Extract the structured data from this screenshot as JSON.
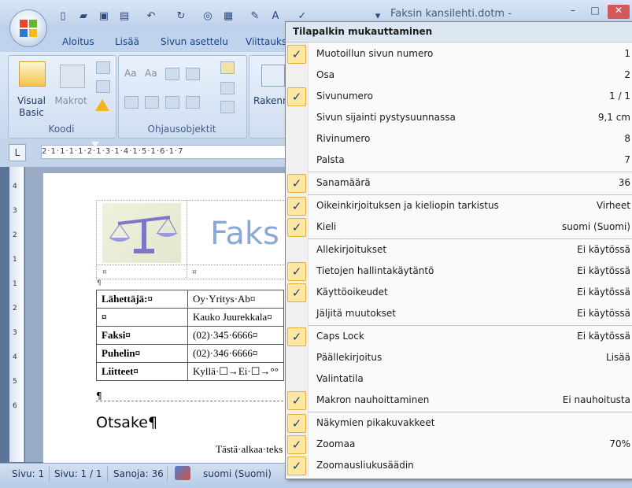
{
  "window": {
    "title": "Faksin kansilehti.dotm - ",
    "minimize_glyph": "–",
    "maximize_glyph": "□",
    "close_glyph": "✕"
  },
  "quick_access": {
    "icons": [
      "new-icon",
      "open-icon",
      "save-icon",
      "print-preview-icon",
      "undo-icon",
      "redo-icon",
      "zoom-icon",
      "print-icon",
      "format-icon",
      "font-icon",
      "check-icon",
      "dropdown-icon"
    ]
  },
  "ribbon": {
    "tabs": [
      "Aloitus",
      "Lisää",
      "Sivun asettelu",
      "Viittaukse"
    ],
    "groups": {
      "koodi": {
        "label": "Koodi",
        "visual_basic": "Visual Basic",
        "makrot": "Makrot"
      },
      "ohjausobjektit": {
        "label": "Ohjausobjektit"
      },
      "rakenne": {
        "label": "Rakenn"
      }
    }
  },
  "ruler": {
    "corner": "L",
    "horizontal_text": "2·1·1·1·1·2·1·3·1·4·1·5·1·6·1·7",
    "vertical_ticks": [
      "4",
      "3",
      "2",
      "1",
      "1",
      "2",
      "3",
      "4",
      "5",
      "6"
    ]
  },
  "document": {
    "fax_title": "Faks",
    "info_rows": [
      {
        "label": "Lähettäjä:¤",
        "value": "Oy·Yritys·Ab¤"
      },
      {
        "label": "¤",
        "value": "Kauko Juurekkala¤"
      },
      {
        "label": "Faksi¤",
        "value": "(02)·345·6666¤"
      },
      {
        "label": "Puhelin¤",
        "value": "(02)·346·6666¤"
      },
      {
        "label": "Liitteet¤",
        "value": "Kyllä·☐→Ei·☐→°°"
      }
    ],
    "heading": "Otsake¶",
    "body_start": "Tästä·alkaa·teks",
    "pilcrow": "¶",
    "cell_marker": "¤"
  },
  "statusbar": {
    "sivu": "Sivu: 1",
    "sivu_of": "Sivu: 1 / 1",
    "sanoja": "Sanoja: 36",
    "kieli": "suomi (Suomi)"
  },
  "menu": {
    "title": "Tilapalkin mukauttaminen",
    "check_glyph": "✓",
    "groups": [
      [
        {
          "label": "Muotoillun sivun numero",
          "value": "1",
          "checked": true
        },
        {
          "label": "Osa",
          "value": "2",
          "checked": false
        },
        {
          "label": "Sivunumero",
          "value": "1 / 1",
          "checked": true
        },
        {
          "label": "Sivun sijainti pystysuunnassa",
          "value": "9,1 cm",
          "checked": false
        },
        {
          "label": "Rivinumero",
          "value": "8",
          "checked": false
        },
        {
          "label": "Palsta",
          "value": "7",
          "checked": false
        }
      ],
      [
        {
          "label": "Sanamäärä",
          "value": "36",
          "checked": true
        }
      ],
      [
        {
          "label": "Oikeinkirjoituksen ja kieliopin tarkistus",
          "value": "Virheet",
          "checked": true
        },
        {
          "label": "Kieli",
          "value": "suomi (Suomi)",
          "checked": true
        }
      ],
      [
        {
          "label": "Allekirjoitukset",
          "value": "Ei käytössä",
          "checked": false
        },
        {
          "label": "Tietojen hallintakäytäntö",
          "value": "Ei käytössä",
          "checked": true
        },
        {
          "label": "Käyttöoikeudet",
          "value": "Ei käytössä",
          "checked": true
        },
        {
          "label": "Jäljitä muutokset",
          "value": "Ei käytössä",
          "checked": false
        }
      ],
      [
        {
          "label": "Caps Lock",
          "value": "Ei käytössä",
          "checked": true
        },
        {
          "label": "Päällekirjoitus",
          "value": "Lisää",
          "checked": false
        },
        {
          "label": "Valintatila",
          "value": "",
          "checked": false
        },
        {
          "label": "Makron nauhoittaminen",
          "value": "Ei nauhoitusta",
          "checked": true
        }
      ],
      [
        {
          "label": "Näkymien pikakuvakkeet",
          "value": "",
          "checked": true
        },
        {
          "label": "Zoomaa",
          "value": "70%",
          "checked": true
        },
        {
          "label": "Zoomausliukusäädin",
          "value": "",
          "checked": true
        }
      ]
    ]
  }
}
